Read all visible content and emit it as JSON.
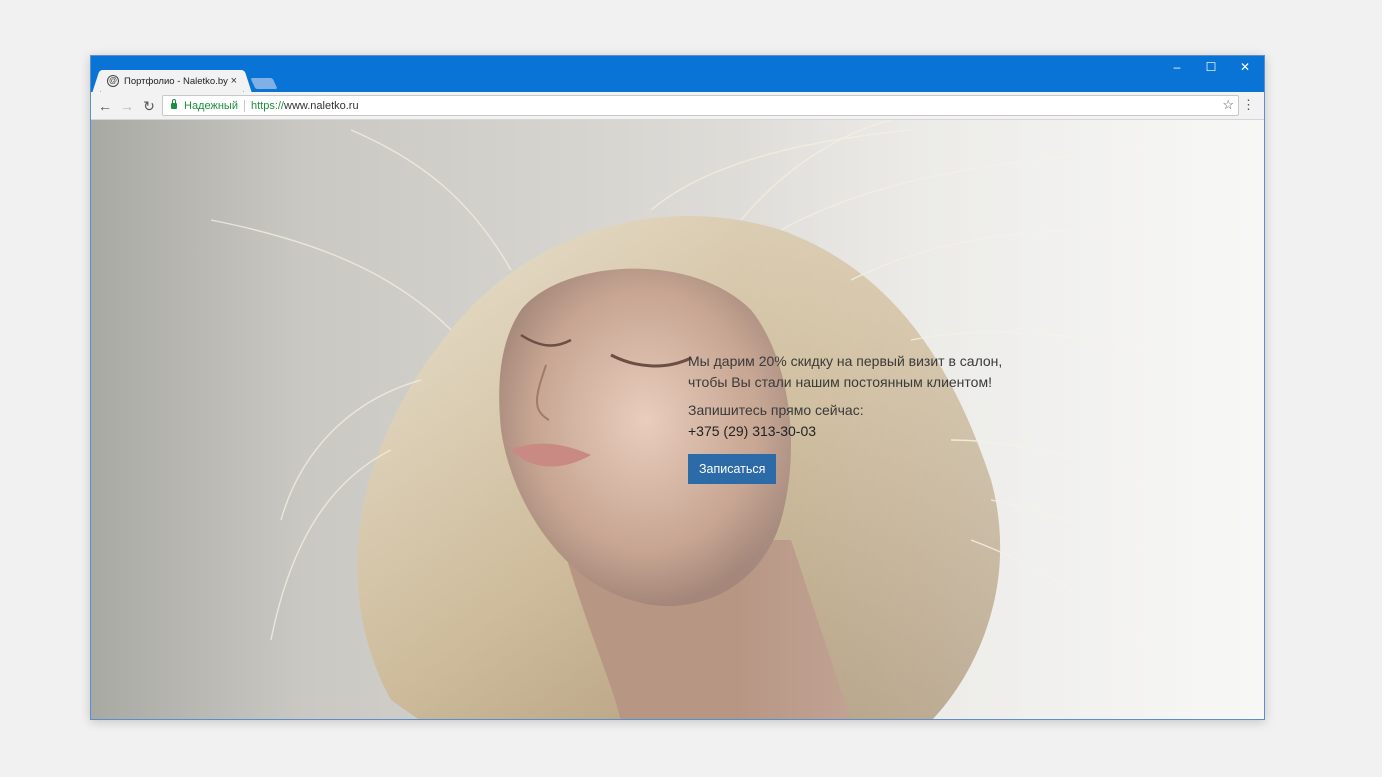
{
  "browser": {
    "tab_title": "Портфолио - Naletko.by",
    "tab_favicon": "@",
    "tab_close": "×",
    "window_controls": {
      "minimize": "–",
      "maximize": "☐",
      "close": "✕"
    },
    "nav": {
      "back": "←",
      "forward": "→",
      "reload": "↻"
    },
    "address": {
      "secure_label": "Надежный",
      "scheme": "https://",
      "host": "www.naletko.ru"
    },
    "bookmark_icon": "☆",
    "menu_icon": "⋮"
  },
  "page": {
    "hero_image": "woman-with-flowing-hair",
    "promo_line1": "Мы дарим 20% скидку на первый визит в салон,",
    "promo_line2": "чтобы Вы стали нашим постоянным клиентом!",
    "cta_label": "Запишитесь прямо сейчас:",
    "phone": "+375 (29) 313-30-03",
    "book_button": "Записаться"
  },
  "colors": {
    "titlebar": "#0a74d6",
    "secure": "#1e8e3e",
    "button": "#2d6ba8"
  }
}
